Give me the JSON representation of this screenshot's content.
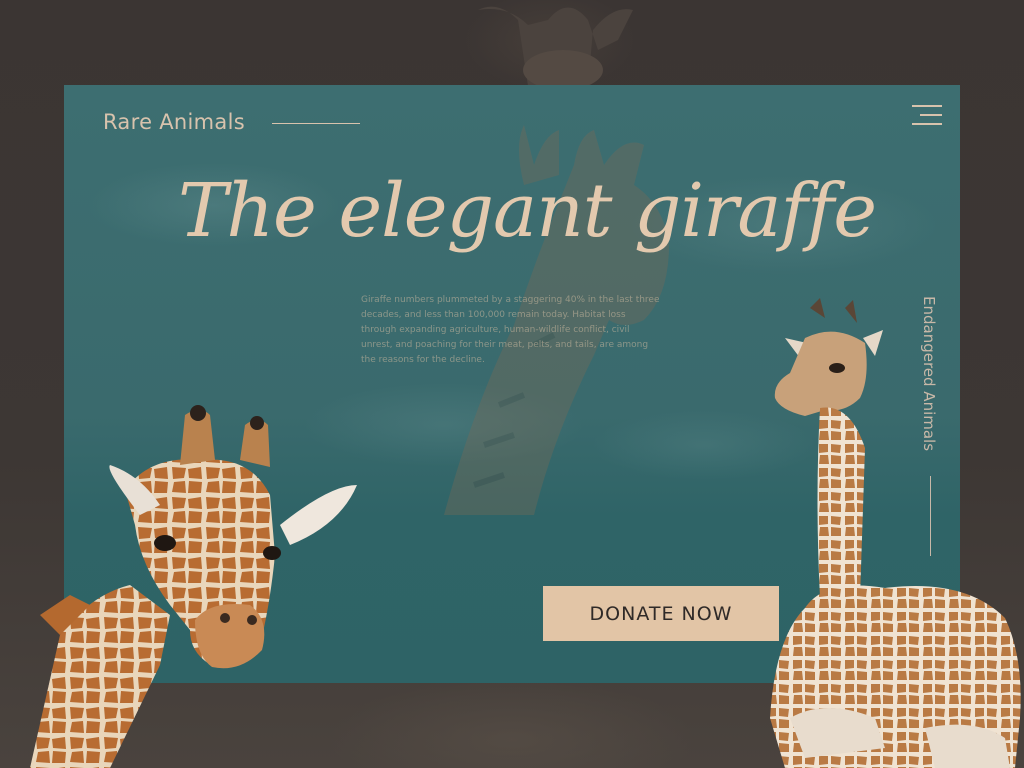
{
  "header": {
    "brand": "Rare Animals"
  },
  "hero": {
    "title": "The elegant giraffe",
    "description": "Giraffe numbers plummeted by a staggering 40% in the last three decades, and less than 100,000 remain today. Habitat loss through expanding agriculture, human-wildlife conflict, civil unrest, and poaching for their meat, pelts, and tails, are among the reasons for the decline."
  },
  "side": {
    "label": "Endangered Animals"
  },
  "cta": {
    "donate_label": "DONATE NOW"
  },
  "icons": {
    "menu": "hamburger-menu-icon"
  },
  "colors": {
    "background": "#3a3432",
    "panel": "#3a6a6d",
    "accent": "#e2c5a6",
    "text_light": "#d8c3ad"
  }
}
